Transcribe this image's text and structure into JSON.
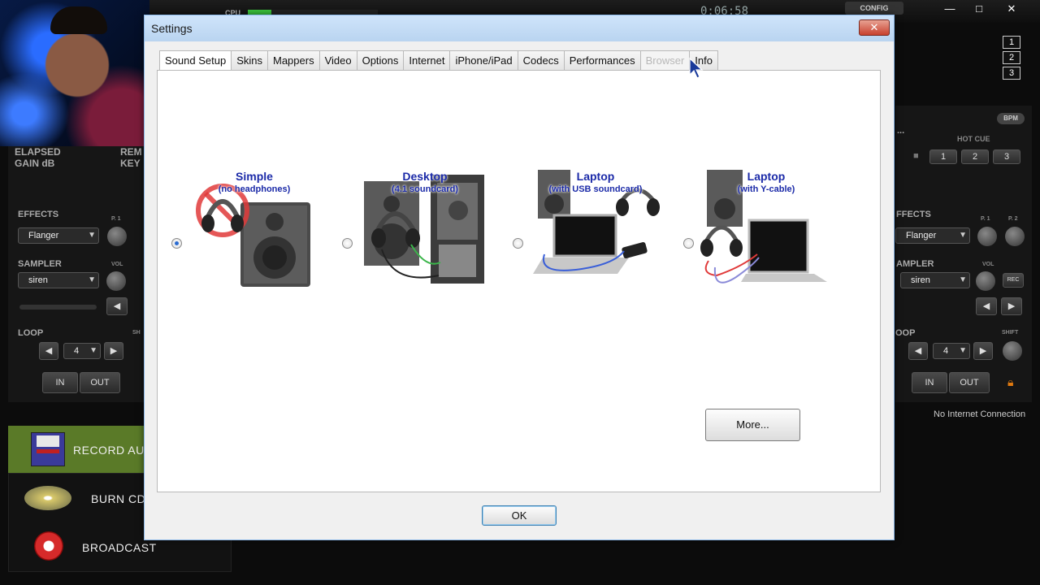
{
  "app": {
    "cpu_label": "CPU",
    "cpu_load_fraction": 0.18,
    "clock": "0:06:58",
    "config_label": "CONFIG",
    "window_controls": [
      "—",
      "□",
      "✕"
    ]
  },
  "left_deck": {
    "elapsed_label": "ELAPSED",
    "gain_label": "GAIN dB",
    "remain_label": "REM",
    "key_label": "KEY",
    "effects_label": "EFFECTS",
    "effect_value": "Flanger",
    "p1_label": "P. 1",
    "sampler_label": "SAMPLER",
    "sampler_value": "siren",
    "vol_label": "VOL",
    "loop_label": "LOOP",
    "shift_label": "SH",
    "loop_value": "4",
    "in_label": "IN",
    "out_label": "OUT"
  },
  "right_deck": {
    "deck_numbers": [
      "1",
      "2",
      "3"
    ],
    "bpm_label": "BPM",
    "hot_cue_label": "HOT CUE",
    "hot_cues": [
      "1",
      "2",
      "3"
    ],
    "effects_label": "FFECTS",
    "effect_value": "Flanger",
    "p1_label": "P. 1",
    "p2_label": "P. 2",
    "sampler_label": "AMPLER",
    "sampler_value": "siren",
    "vol_label": "VOL",
    "rec_label": "REC",
    "loop_label": "OOP",
    "shift_label": "SHIFT",
    "loop_value": "4",
    "in_label": "IN",
    "out_label": "OUT",
    "more_dots": "..."
  },
  "status": {
    "no_internet": "No Internet Connection"
  },
  "side_menu": {
    "record": "RECORD AU",
    "burn": "BURN CD",
    "broadcast": "BROADCAST"
  },
  "dialog": {
    "title": "Settings",
    "close_label": "✕",
    "tabs": [
      {
        "label": "Sound Setup",
        "state": "active"
      },
      {
        "label": "Skins",
        "state": "normal"
      },
      {
        "label": "Mappers",
        "state": "normal"
      },
      {
        "label": "Video",
        "state": "normal"
      },
      {
        "label": "Options",
        "state": "normal"
      },
      {
        "label": "Internet",
        "state": "normal"
      },
      {
        "label": "iPhone/iPad",
        "state": "normal"
      },
      {
        "label": "Codecs",
        "state": "normal"
      },
      {
        "label": "Performances",
        "state": "normal"
      },
      {
        "label": "Browser",
        "state": "disabled"
      },
      {
        "label": "Info",
        "state": "normal"
      }
    ],
    "options": [
      {
        "title": "Simple",
        "subtitle": "(no headphones)",
        "selected": true
      },
      {
        "title": "Desktop",
        "subtitle": "(4.1 soundcard)",
        "selected": false
      },
      {
        "title": "Laptop",
        "subtitle": "(with USB soundcard)",
        "selected": false
      },
      {
        "title": "Laptop",
        "subtitle": "(with Y-cable)",
        "selected": false
      }
    ],
    "more_label": "More...",
    "ok_label": "OK"
  }
}
